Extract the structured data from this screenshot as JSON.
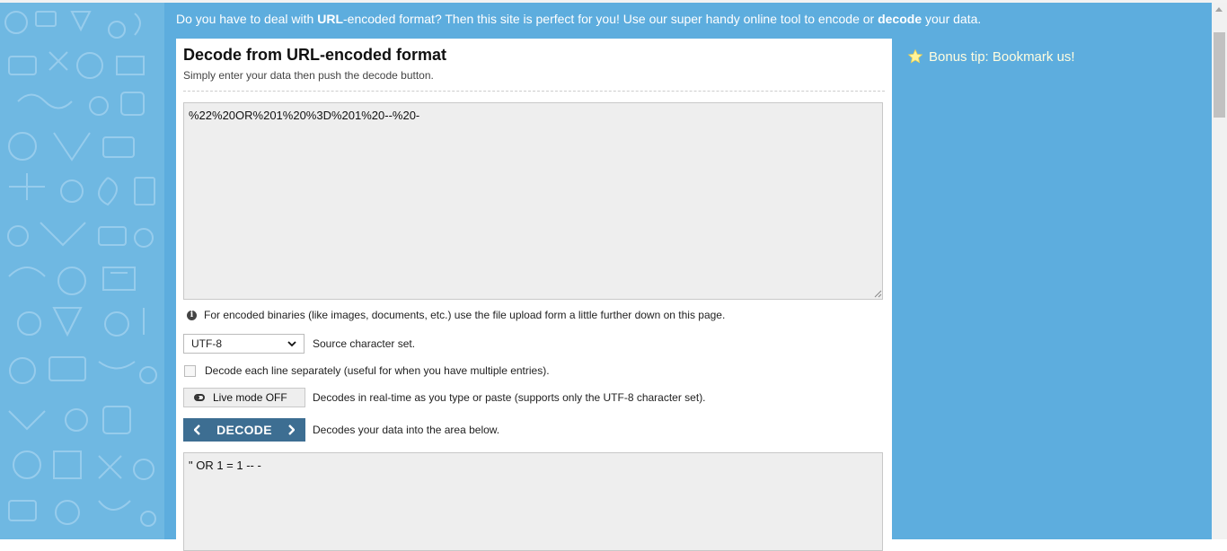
{
  "intro": {
    "part1": "Do you have to deal with ",
    "bold1": "URL",
    "part2": "-encoded format? Then this site is perfect for you! Use our super handy online tool to encode or ",
    "bold2": "decode",
    "part3": " your data."
  },
  "card": {
    "title": "Decode from URL-encoded format",
    "subtitle": "Simply enter your data then push the decode button."
  },
  "input": {
    "value": "%22%20OR%201%20%3D%201%20--%20-"
  },
  "info": {
    "text": "For encoded binaries (like images, documents, etc.) use the file upload form a little further down on this page."
  },
  "charset": {
    "selected": "UTF-8",
    "label": "Source character set."
  },
  "lines": {
    "label": "Decode each line separately (useful for when you have multiple entries)."
  },
  "live": {
    "button_label": "Live mode OFF",
    "description": "Decodes in real-time as you type or paste (supports only the UTF-8 character set)."
  },
  "decode": {
    "button_label": "DECODE",
    "description": "Decodes your data into the area below."
  },
  "output": {
    "value": "\" OR 1 = 1 -- -"
  },
  "sidebar": {
    "tip": "Bonus tip: Bookmark us!"
  },
  "colors": {
    "band": "#5dadde",
    "decode_button": "#3d6e92",
    "tip_text": "#fffde0"
  }
}
